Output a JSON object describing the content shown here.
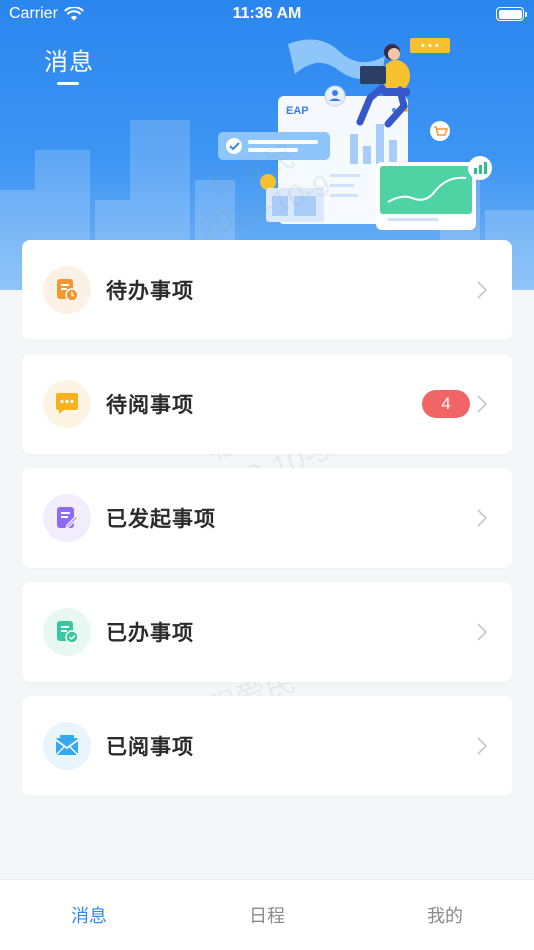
{
  "status_bar": {
    "carrier": "Carrier",
    "time": "11:36 AM"
  },
  "header": {
    "title": "消息",
    "illustration_label": "EAP"
  },
  "items": [
    {
      "label": "待办事项",
      "icon": "pending-task-icon",
      "icon_bg": "#fdf1e6",
      "icon_color": "#f5962f",
      "badge": ""
    },
    {
      "label": "待阅事项",
      "icon": "pending-read-message-icon",
      "icon_bg": "#fdf5e3",
      "icon_color": "#f7b21e",
      "badge": "4"
    },
    {
      "label": "已发起事项",
      "icon": "initiated-edit-icon",
      "icon_bg": "#f1edfd",
      "icon_color": "#8d6bf2",
      "badge": ""
    },
    {
      "label": "已办事项",
      "icon": "done-check-icon",
      "icon_bg": "#e7f8f2",
      "icon_color": "#35c99b",
      "badge": ""
    },
    {
      "label": "已阅事项",
      "icon": "read-envelope-icon",
      "icon_bg": "#e8f5fd",
      "icon_color": "#35a9f0",
      "badge": ""
    }
  ],
  "watermark": {
    "name": "程爱民",
    "date": "2023-10-9"
  },
  "tabs": [
    {
      "label": "消息",
      "active": true
    },
    {
      "label": "日程",
      "active": false
    },
    {
      "label": "我的",
      "active": false
    }
  ],
  "colors": {
    "primary": "#2f8af0",
    "badge": "#f26567"
  }
}
